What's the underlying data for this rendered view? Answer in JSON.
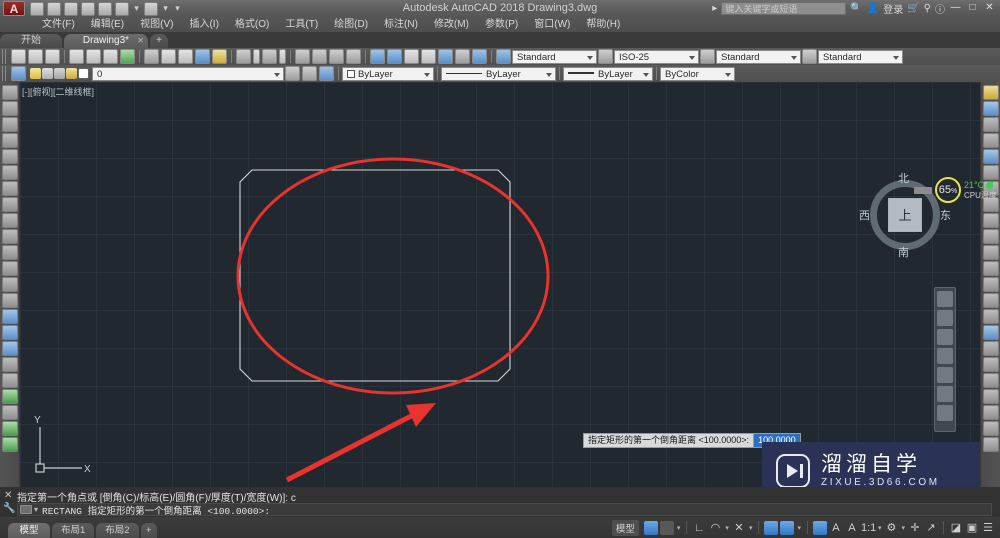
{
  "titlebar": {
    "app_logo": "A",
    "title": "Autodesk AutoCAD 2018    Drawing3.dwg",
    "search_placeholder": "键入关键字或短语",
    "signin_label": "登录",
    "minimize": "—",
    "maximize": "□",
    "close": "✕"
  },
  "menubar": {
    "items": [
      {
        "label": "文件(F)"
      },
      {
        "label": "编辑(E)"
      },
      {
        "label": "视图(V)"
      },
      {
        "label": "插入(I)"
      },
      {
        "label": "格式(O)"
      },
      {
        "label": "工具(T)"
      },
      {
        "label": "绘图(D)"
      },
      {
        "label": "标注(N)"
      },
      {
        "label": "修改(M)"
      },
      {
        "label": "参数(P)"
      },
      {
        "label": "窗口(W)"
      },
      {
        "label": "帮助(H)"
      }
    ]
  },
  "doctabs": {
    "items": [
      {
        "label": "开始",
        "active": false
      },
      {
        "label": "Drawing3*",
        "active": true
      }
    ],
    "add_label": "+"
  },
  "toolbar_row1": {
    "style_combo": "Standard",
    "dimstyle_combo": "ISO-25",
    "tablestyle_combo": "Standard",
    "mleaderstyle_combo": "Standard"
  },
  "toolbar_row2": {
    "layer_name": "0",
    "color_combo": "ByLayer",
    "linetype_combo": "ByLayer",
    "lineweight_combo": "ByLayer",
    "plotstyle_combo": "ByColor"
  },
  "canvas": {
    "viewport_label": "[-][俯视][二维线框]",
    "ucs_x": "X",
    "ucs_y": "Y",
    "background_color": "#212830",
    "entity_color": "#d5d9de",
    "annotation_color": "#e8332f"
  },
  "viewcube": {
    "top": "上",
    "north": "北",
    "south": "南",
    "west": "西",
    "east": "东"
  },
  "cpu_widget": {
    "percent": "65",
    "percent_unit": "%",
    "temperature": "21°C",
    "label": "CPU温度"
  },
  "dynamic_input": {
    "prompt": "指定矩形的第一个倒角距离 <100.0000>:",
    "value": "100.0000"
  },
  "command_line": {
    "history": "指定第一个角点或 [倒角(C)/标高(E)/圆角(F)/厚度(T)/宽度(W)]: c",
    "current": "RECTANG 指定矩形的第一个倒角距离 <100.0000>:",
    "close_icon": "✕"
  },
  "statusbar": {
    "tabs": [
      {
        "label": "模型",
        "active": true
      },
      {
        "label": "布局1",
        "active": false
      },
      {
        "label": "布局2",
        "active": false
      }
    ],
    "add_label": "+",
    "model_label": "模型",
    "icons": [
      {
        "name": "grid-display-toggle",
        "on": true
      },
      {
        "name": "snap-mode-toggle",
        "on": false
      },
      {
        "name": "ortho-mode-toggle",
        "on": false
      },
      {
        "name": "polar-tracking-toggle",
        "on": false
      },
      {
        "name": "isometric-drafting-toggle",
        "on": false
      },
      {
        "name": "object-snap-tracking-toggle",
        "on": true
      },
      {
        "name": "object-snap-toggle",
        "on": true
      },
      {
        "name": "annotation-visibility-toggle",
        "on": true
      },
      {
        "name": "annotation-scale-auto",
        "on": false
      },
      {
        "name": "annotation-scale-add",
        "on": false
      },
      {
        "name": "workspace-switching",
        "on": false
      },
      {
        "name": "hardware-acceleration",
        "on": false
      },
      {
        "name": "isolate-objects",
        "on": false
      },
      {
        "name": "clean-screen",
        "on": false
      },
      {
        "name": "customization-menu",
        "on": false
      }
    ]
  },
  "watermark": {
    "cn": "溜溜自学",
    "en": "ZIXUE.3D66.COM",
    "bg_color": "#2a3356"
  }
}
